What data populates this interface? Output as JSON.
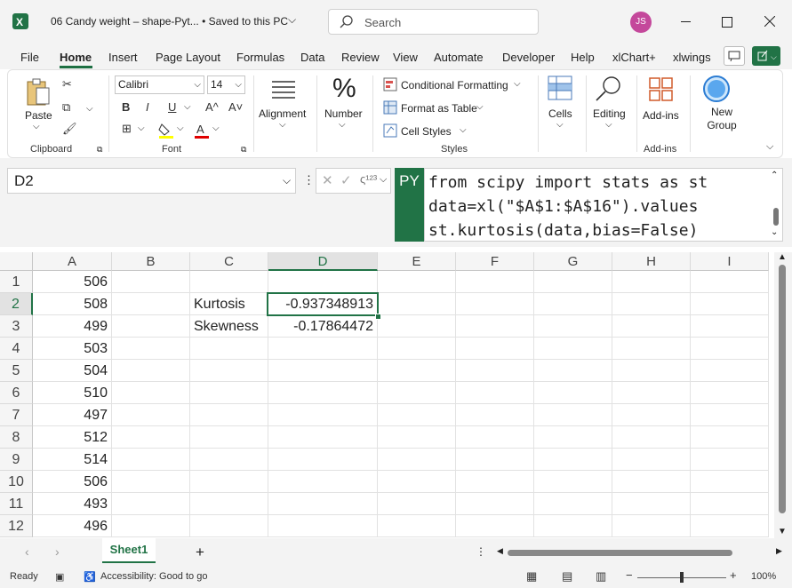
{
  "window": {
    "title": "06 Candy weight – shape-Pyt...  •  Saved to this PC",
    "search_placeholder": "Search",
    "user_initials": "JS"
  },
  "menu": [
    "File",
    "Home",
    "Insert",
    "Page Layout",
    "Formulas",
    "Data",
    "Review",
    "View",
    "Automate",
    "Developer",
    "Help",
    "xlChart+",
    "xlwings"
  ],
  "ribbon": {
    "clipboard": {
      "paste": "Paste",
      "label": "Clipboard"
    },
    "font": {
      "family": "Calibri",
      "size": "14",
      "bold": "B",
      "italic": "I",
      "underline": "U",
      "grow": "A^",
      "shrink": "A˅",
      "label": "Font"
    },
    "alignment": {
      "label": "Alignment"
    },
    "number": {
      "label": "Number",
      "symbol": "%"
    },
    "styles": {
      "conditional": "Conditional Formatting",
      "table": "Format as Table",
      "cell_styles": "Cell Styles",
      "label": "Styles"
    },
    "cells": {
      "label": "Cells"
    },
    "editing": {
      "label": "Editing"
    },
    "addins": {
      "button": "Add-ins",
      "label": "Add-ins"
    },
    "new_group": {
      "label": "New Group"
    }
  },
  "formula_bar": {
    "name_box": "D2",
    "py_badge": "PY",
    "lines": [
      "from scipy import stats as st",
      "data=xl(\"$A$1:$A$16\").values",
      "st.kurtosis(data,bias=False)"
    ]
  },
  "grid": {
    "columns": [
      "A",
      "B",
      "C",
      "D",
      "E",
      "F",
      "G",
      "H",
      "I"
    ],
    "rows": [
      "1",
      "2",
      "3",
      "4",
      "5",
      "6",
      "7",
      "8",
      "9",
      "10",
      "11",
      "12"
    ],
    "col_a": [
      "506",
      "508",
      "499",
      "503",
      "504",
      "510",
      "497",
      "512",
      "514",
      "506",
      "493",
      "496"
    ],
    "c2": "Kurtosis",
    "c3": "Skewness",
    "d2": "-0.937348913",
    "d3": "-0.17864472"
  },
  "sheets": {
    "active": "Sheet1",
    "add": "+"
  },
  "status": {
    "ready": "Ready",
    "accessibility": "Accessibility: Good to go",
    "zoom": "100%"
  },
  "colors": {
    "accent": "#217346",
    "avatar": "#c4489b"
  }
}
